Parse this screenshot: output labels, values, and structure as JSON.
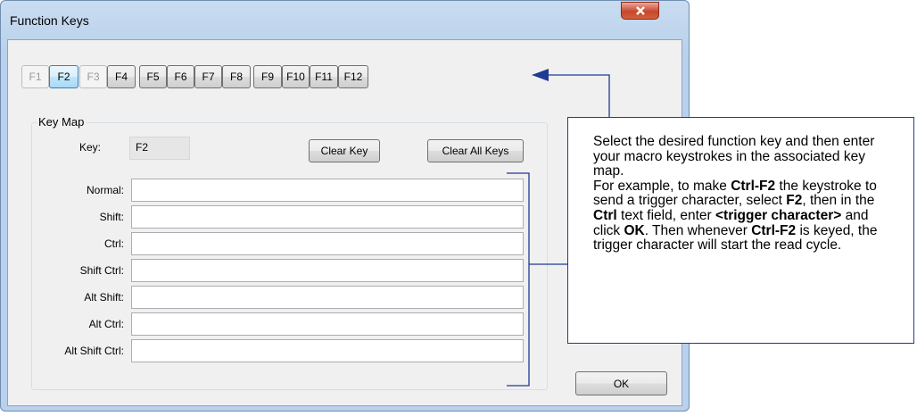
{
  "window": {
    "title": "Function Keys",
    "close_label": "x"
  },
  "function_keys": [
    {
      "label": "F1",
      "state": "disabled"
    },
    {
      "label": "F2",
      "state": "selected"
    },
    {
      "label": "F3",
      "state": "disabled"
    },
    {
      "label": "F4",
      "state": "enabled"
    },
    {
      "label": "F5",
      "state": "enabled"
    },
    {
      "label": "F6",
      "state": "enabled"
    },
    {
      "label": "F7",
      "state": "enabled"
    },
    {
      "label": "F8",
      "state": "enabled"
    },
    {
      "label": "F9",
      "state": "enabled"
    },
    {
      "label": "F10",
      "state": "enabled"
    },
    {
      "label": "F11",
      "state": "enabled"
    },
    {
      "label": "F12",
      "state": "enabled"
    }
  ],
  "key_map": {
    "group_label": "Key Map",
    "key_label": "Key:",
    "key_value": "F2",
    "clear_key": "Clear Key",
    "clear_all_keys": "Clear All Keys",
    "fields": [
      {
        "label": "Normal:",
        "value": ""
      },
      {
        "label": "Shift:",
        "value": ""
      },
      {
        "label": "Ctrl:",
        "value": ""
      },
      {
        "label": "Shift Ctrl:",
        "value": ""
      },
      {
        "label": "Alt Shift:",
        "value": ""
      },
      {
        "label": "Alt Ctrl:",
        "value": ""
      },
      {
        "label": "Alt Shift Ctrl:",
        "value": ""
      }
    ]
  },
  "ok_button": "OK",
  "callout": {
    "line1": "Select the desired function key and then enter your macro keystrokes in the associated key map.",
    "p2_a": "For example, to make ",
    "p2_b": "Ctrl-F2",
    "p2_c": " the keystroke to send a trigger character, select ",
    "p2_d": "F2",
    "p2_e": ", then in the ",
    "p2_f": "Ctrl",
    "p2_g": " text field, enter ",
    "p2_h": "<trigger character>",
    "p2_i": " and click ",
    "p2_j": "OK",
    "p2_k": ". Then whenever ",
    "p2_l": "Ctrl-F2",
    "p2_m": " is keyed, the trigger character will start the read cycle."
  },
  "colors": {
    "callout_line": "#1f3b93",
    "window_frame": "#b9d1ec"
  }
}
